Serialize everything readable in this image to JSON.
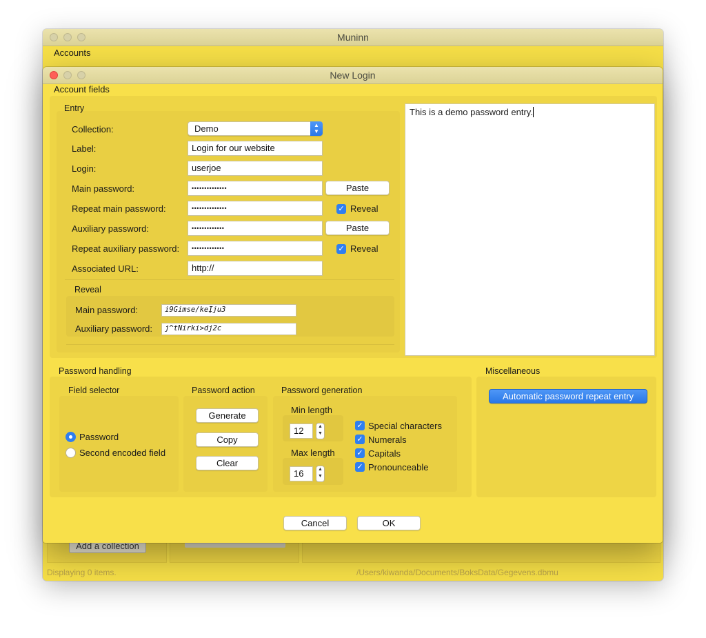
{
  "main_window": {
    "title": "Muninn",
    "menu_label": "Accounts",
    "add_collection_label": "Add a collection",
    "footer_status": "Displaying 0 items.",
    "footer_path": "/Users/kiwanda/Documents/BoksData/Gegevens.dbmu"
  },
  "dialog": {
    "title": "New Login",
    "section_label": "Account fields",
    "entry": {
      "header": "Entry",
      "collection_label": "Collection:",
      "collection_value": "Demo",
      "label_label": "Label:",
      "label_value": "Login for our website",
      "login_label": "Login:",
      "login_value": "userjoe",
      "main_password_label": "Main password:",
      "main_password_value": "••••••••••••••",
      "repeat_main_password_label": "Repeat main password:",
      "repeat_main_password_value": "••••••••••••••",
      "aux_password_label": "Auxiliary password:",
      "aux_password_value": "•••••••••••••",
      "repeat_aux_password_label": "Repeat auxiliary password:",
      "repeat_aux_password_value": "•••••••••••••",
      "url_label": "Associated URL:",
      "url_value": "http://",
      "paste_label": "Paste",
      "reveal_label": "Reveal"
    },
    "reveal": {
      "header": "Reveal",
      "main_password_label": "Main password:",
      "main_password_value": "i9Gimse/keĮju3",
      "aux_password_label": "Auxiliary password:",
      "aux_password_value": "j^tNirki>dj2c"
    },
    "notes": "This is a demo password entry.",
    "password_handling": {
      "header": "Password handling",
      "field_selector": {
        "header": "Field selector",
        "options": [
          "Password",
          "Second encoded field"
        ],
        "selected": "Password"
      },
      "password_action": {
        "header": "Password action",
        "generate_label": "Generate",
        "copy_label": "Copy",
        "clear_label": "Clear"
      },
      "password_generation": {
        "header": "Password generation",
        "min_length_label": "Min length",
        "min_length_value": "12",
        "max_length_label": "Max length",
        "max_length_value": "16",
        "options": [
          "Special characters",
          "Numerals",
          "Capitals",
          "Pronounceable"
        ]
      }
    },
    "miscellaneous": {
      "header": "Miscellaneous",
      "auto_repeat_label": "Automatic password repeat entry"
    },
    "cancel_label": "Cancel",
    "ok_label": "OK"
  },
  "colors": {
    "window_yellow": "#f8e04a",
    "group_yellow": "#eed545",
    "accent_blue": "#2f7ff0",
    "close_red": "#fe5f57"
  }
}
